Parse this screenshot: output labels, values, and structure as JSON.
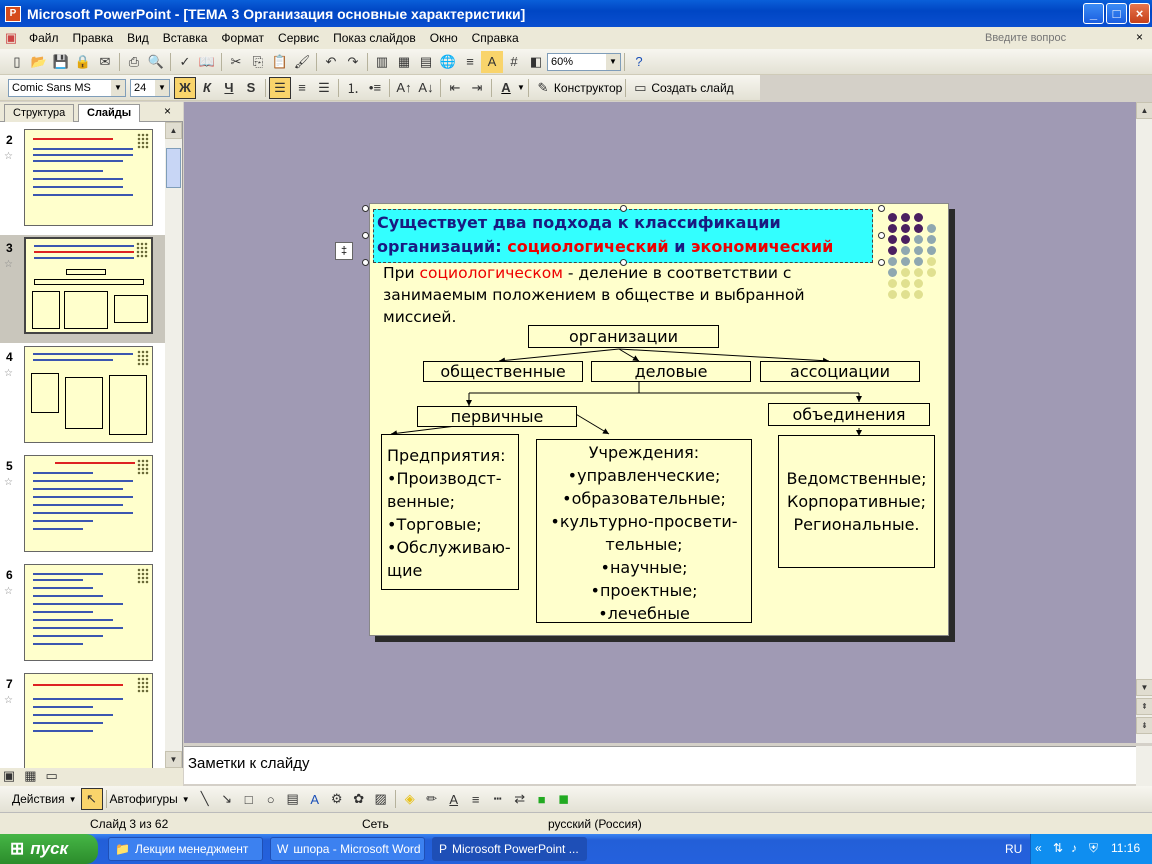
{
  "window": {
    "title": "Microsoft PowerPoint - [ТЕМА 3 Организация основные характеристики]"
  },
  "menu": {
    "items": [
      "Файл",
      "Правка",
      "Вид",
      "Вставка",
      "Формат",
      "Сервис",
      "Показ слайдов",
      "Окно",
      "Справка"
    ],
    "help_placeholder": "Введите вопрос"
  },
  "toolbar": {
    "zoom": "60%",
    "font": "Comic Sans MS",
    "size": "24",
    "bold": "Ж",
    "italic": "К",
    "underline": "Ч",
    "shadow": "S",
    "designer": "Конструктор",
    "new_slide": "Создать слайд"
  },
  "panel": {
    "tab_outline": "Структура",
    "tab_slides": "Слайды",
    "thumbs": [
      {
        "num": "2"
      },
      {
        "num": "3"
      },
      {
        "num": "4"
      },
      {
        "num": "5"
      },
      {
        "num": "6"
      },
      {
        "num": "7"
      }
    ]
  },
  "slide": {
    "title_line1": "Существует два подхода к классификации",
    "title_line2_a": "организаций: ",
    "title_line2_b": "социологический",
    "title_line2_c": " и ",
    "title_line2_d": "экономический",
    "body_a": "При ",
    "body_b": "социологическом",
    "body_c": "  - деление в соответствии с занимаемым положением в обществе и выбранной миссией.",
    "root": "организации",
    "cat1": "общественные",
    "cat2": "деловые",
    "cat3": "ассоциации",
    "sub1": "первичные",
    "sub2": "объединения",
    "box1": [
      "Предприятия:",
      "•Производст-венные;",
      "•Торговые;",
      "•Обслуживаю-щие"
    ],
    "box2": [
      "Учреждения:",
      "•управленческие;",
      "•образовательные;",
      "•культурно-просвети-тельные;",
      "•научные;",
      "•проектные;",
      "•лечебные"
    ],
    "box3": [
      "Ведомственные;",
      "Корпоративные;",
      "Региональные."
    ]
  },
  "notes": {
    "placeholder": "Заметки к слайду"
  },
  "drawbar": {
    "actions": "Действия",
    "autoshapes": "Автофигуры"
  },
  "status": {
    "slide": "Слайд 3 из 62",
    "design": "Сеть",
    "language": "русский (Россия)"
  },
  "taskbar": {
    "start": "пуск",
    "tasks": [
      "Лекции менеджмент",
      "шпора - Microsoft Word",
      "Microsoft PowerPoint ..."
    ],
    "lang": "RU",
    "time": "11:16"
  }
}
